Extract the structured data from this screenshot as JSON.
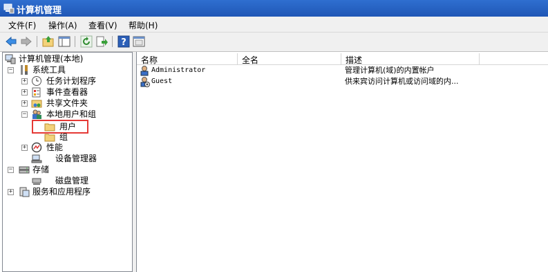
{
  "window": {
    "title": "计算机管理"
  },
  "menu": {
    "items": [
      "文件(F)",
      "操作(A)",
      "查看(V)",
      "帮助(H)"
    ]
  },
  "toolbar": {
    "buttons": [
      "back-icon",
      "forward-icon",
      "up-folder-icon",
      "show-hide-tree-icon",
      "refresh-icon",
      "export-list-icon",
      "help-icon",
      "properties-icon"
    ]
  },
  "tree": {
    "root": "计算机管理(本地)",
    "system_tools": "系统工具",
    "task_scheduler": "任务计划程序",
    "event_viewer": "事件查看器",
    "shared_folders": "共享文件夹",
    "local_users_groups": "本地用户和组",
    "users": "用户",
    "groups": "组",
    "performance": "性能",
    "device_manager": "设备管理器",
    "storage": "存储",
    "disk_management": "磁盘管理",
    "services_apps": "服务和应用程序"
  },
  "list": {
    "columns": [
      "名称",
      "全名",
      "描述"
    ],
    "rows": [
      {
        "name": "Administrator",
        "full_name": "",
        "description": "管理计算机(域)的内置帐户"
      },
      {
        "name": "Guest",
        "full_name": "",
        "description": "供来宾访问计算机或访问域的内..."
      }
    ]
  },
  "colors": {
    "title_bar": "#1f56b5",
    "highlight_box": "#e53935",
    "folder": "#f3d27a"
  }
}
